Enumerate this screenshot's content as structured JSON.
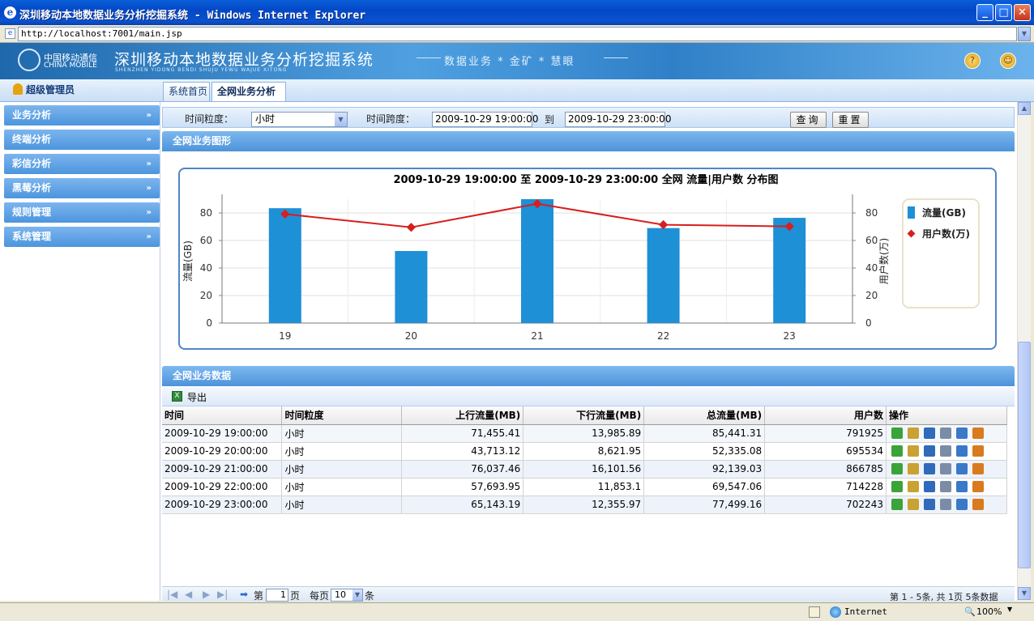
{
  "window": {
    "title": "深圳移动本地数据业务分析挖掘系统 - Windows Internet Explorer",
    "url": "http://localhost:7001/main.jsp",
    "minimize": "_",
    "maximize": "□",
    "close": "✕"
  },
  "header": {
    "cm_cn": "中国移动通信",
    "cm_en": "CHINA MOBILE",
    "system_name": "深圳移动本地数据业务分析挖掘系统",
    "system_pinyin": "SHENZHEN YIDONG BENDI SHUJU YEWU WAJUE XITONG",
    "slogan": "数据业务 * 金矿 * 慧眼"
  },
  "user": {
    "role": "超级管理员"
  },
  "tabs": [
    {
      "label": "系统首页"
    },
    {
      "label": "全网业务分析"
    }
  ],
  "menu": [
    {
      "label": "业务分析"
    },
    {
      "label": "终端分析"
    },
    {
      "label": "彩信分析"
    },
    {
      "label": "黑莓分析"
    },
    {
      "label": "规则管理"
    },
    {
      "label": "系统管理"
    }
  ],
  "menu_arrow": "»",
  "query": {
    "granularity_label": "时间粒度：",
    "granularity_value": "小时",
    "span_label": "时间跨度：",
    "start": "2009-10-29 19:00:00",
    "to": "到",
    "end": "2009-10-29 23:00:00",
    "search": "查询",
    "reset": "重置"
  },
  "chart_panel": {
    "title": "全网业务图形"
  },
  "chart_data": {
    "type": "bar",
    "title": "2009-10-29 19:00:00 至 2009-10-29 23:00:00 全网 流量|用户数 分布图",
    "categories": [
      "19",
      "20",
      "21",
      "22",
      "23"
    ],
    "series": [
      {
        "name": "流量(GB)",
        "type": "bar",
        "axis": "left",
        "values": [
          83.44,
          52.34,
          90.21,
          69.01,
          76.43
        ],
        "color": "#1e90d6"
      },
      {
        "name": "用户数(万)",
        "type": "line",
        "axis": "right",
        "values": [
          79.19,
          69.55,
          86.68,
          71.42,
          70.22
        ],
        "color": "#d81e1e"
      }
    ],
    "ylabel": "流量(GB)",
    "y2label": "用户数(万)",
    "ylim": [
      0,
      90
    ],
    "y2lim": [
      0,
      90
    ],
    "yticks": [
      0,
      20,
      40,
      60,
      80
    ],
    "legend": "right",
    "grid": true
  },
  "data_panel": {
    "title": "全网业务数据",
    "export": "导出"
  },
  "table": {
    "headers": [
      "时间",
      "时间粒度",
      "上行流量(MB)",
      "下行流量(MB)",
      "总流量(MB)",
      "用户数",
      "操作"
    ],
    "rows": [
      [
        "2009-10-29 19:00:00",
        "小时",
        "71,455.41",
        "13,985.89",
        "85,441.31",
        "791925"
      ],
      [
        "2009-10-29 20:00:00",
        "小时",
        "43,713.12",
        "8,621.95",
        "52,335.08",
        "695534"
      ],
      [
        "2009-10-29 21:00:00",
        "小时",
        "76,037.46",
        "16,101.56",
        "92,139.03",
        "866785"
      ],
      [
        "2009-10-29 22:00:00",
        "小时",
        "57,693.95",
        "11,853.1",
        "69,547.06",
        "714228"
      ],
      [
        "2009-10-29 23:00:00",
        "小时",
        "65,143.19",
        "12,355.97",
        "77,499.16",
        "702243"
      ]
    ]
  },
  "pager": {
    "first": "|◀",
    "prev": "◀",
    "next": "▶",
    "last": "▶|",
    "page_pre": "第",
    "page_value": "1",
    "page_post": "页",
    "size_pre": "每页",
    "size_value": "10",
    "size_post": "条",
    "info": "第 1 - 5条, 共 1页  5条数据"
  },
  "status": {
    "zone": "Internet",
    "zoom": "100%"
  }
}
